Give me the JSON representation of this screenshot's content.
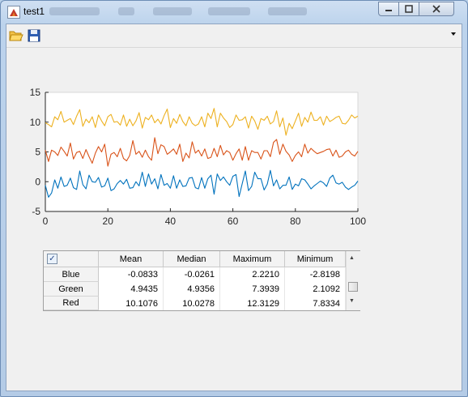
{
  "window": {
    "title": "test1"
  },
  "toolbar": {
    "open_icon": "folder-open-icon",
    "save_icon": "floppy-save-icon",
    "overflow_icon": "chevron-down-icon"
  },
  "chart_data": {
    "type": "line",
    "xlim": [
      0,
      100
    ],
    "ylim": [
      -5,
      15
    ],
    "x_ticks": [
      "0",
      "20",
      "40",
      "60",
      "80",
      "100"
    ],
    "y_ticks": [
      "15",
      "10",
      "5",
      "0",
      "-5"
    ],
    "grid": false,
    "legend": "none",
    "series": [
      {
        "color": "#edb120",
        "values": [
          9.9,
          9.6,
          9.2,
          10.9,
          10.4,
          11.8,
          10.0,
          10.3,
          10.6,
          9.6,
          11.0,
          12.1,
          9.3,
          10.5,
          9.9,
          10.9,
          9.1,
          11.2,
          10.2,
          9.4,
          10.9,
          11.3,
          10.0,
          10.1,
          9.5,
          11.2,
          9.3,
          10.5,
          9.4,
          10.2,
          11.6,
          9.0,
          10.8,
          10.4,
          11.2,
          9.9,
          10.5,
          9.7,
          11.1,
          12.2,
          9.1,
          10.6,
          9.8,
          11.3,
          10.1,
          9.4,
          10.9,
          9.8,
          9.4,
          9.7,
          10.9,
          9.2,
          11.5,
          10.6,
          12.3,
          9.2,
          11.5,
          10.7,
          10.1,
          9.1,
          9.6,
          11.2,
          10.3,
          10.4,
          10.9,
          9.0,
          11.0,
          10.2,
          8.8,
          10.6,
          10.3,
          11.0,
          9.7,
          10.1,
          11.9,
          9.2,
          10.7,
          7.8,
          9.8,
          8.9,
          10.2,
          11.5,
          9.3,
          10.8,
          10.0,
          11.7,
          10.3,
          10.3,
          10.9,
          9.5,
          11.0,
          10.1,
          10.4,
          10.8,
          11.0,
          9.8,
          9.7,
          10.3,
          11.2,
          10.7,
          11.0
        ]
      },
      {
        "color": "#d95319",
        "values": [
          5.3,
          3.4,
          5.3,
          5.0,
          4.4,
          5.8,
          5.1,
          4.3,
          6.5,
          3.8,
          4.9,
          5.1,
          3.9,
          5.4,
          4.2,
          3.1,
          4.8,
          5.9,
          5.0,
          6.3,
          2.6,
          4.6,
          4.9,
          4.2,
          5.6,
          3.9,
          3.5,
          4.4,
          6.9,
          4.6,
          5.1,
          4.1,
          5.3,
          4.2,
          3.6,
          7.4,
          4.7,
          6.2,
          5.9,
          4.6,
          5.0,
          5.5,
          4.6,
          6.3,
          3.4,
          4.8,
          4.0,
          6.7,
          4.8,
          5.3,
          4.3,
          5.5,
          3.9,
          4.1,
          5.6,
          4.2,
          6.1,
          4.5,
          5.2,
          4.9,
          3.6,
          4.7,
          5.5,
          3.6,
          5.9,
          3.6,
          5.2,
          4.9,
          4.9,
          3.8,
          5.2,
          5.2,
          4.2,
          6.6,
          7.1,
          4.6,
          6.3,
          5.1,
          4.5,
          3.4,
          4.4,
          5.0,
          4.2,
          6.3,
          4.8,
          5.6,
          5.1,
          4.7,
          4.9,
          5.1,
          5.4,
          5.5,
          4.3,
          5.3,
          4.1,
          4.3,
          5.0,
          5.3,
          4.6,
          4.3,
          5.1
        ]
      },
      {
        "color": "#0072bd",
        "values": [
          -0.6,
          -2.6,
          -1.9,
          0.3,
          -1.1,
          0.8,
          -0.8,
          -0.6,
          0.6,
          -1.0,
          -1.3,
          1.8,
          -0.5,
          -1.2,
          1.1,
          0.0,
          -0.1,
          0.7,
          -0.9,
          -0.7,
          0.6,
          -1.5,
          -1.2,
          -0.3,
          0.2,
          -0.4,
          0.4,
          -1.1,
          -1.0,
          0.0,
          -0.7,
          1.6,
          -0.8,
          1.3,
          -0.4,
          0.5,
          -1.2,
          1.2,
          -0.6,
          -0.3,
          -1.1,
          1.0,
          -1.1,
          0.3,
          -0.8,
          -0.7,
          0.6,
          0.7,
          -1.0,
          -1.2,
          0.7,
          -1.1,
          0.5,
          1.1,
          -2.1,
          1.3,
          0.2,
          0.8,
          0.0,
          -0.6,
          0.9,
          1.2,
          -2.5,
          -0.3,
          1.8,
          -1.5,
          -0.8,
          1.6,
          0.5,
          0.5,
          -1.4,
          -0.4,
          1.9,
          -0.7,
          0.3,
          -1.2,
          -0.6,
          -0.6,
          0.8,
          -1.3,
          -0.4,
          -0.7,
          0.5,
          0.3,
          -0.4,
          -1.2,
          -0.7,
          -0.3,
          0.1,
          -0.2,
          -0.8,
          0.6,
          1.1,
          -0.2,
          -0.4,
          -0.1,
          -0.9,
          -1.3,
          -0.9,
          -0.6,
          0.1
        ]
      }
    ]
  },
  "table": {
    "checked": true,
    "columns": [
      "Mean",
      "Median",
      "Maximum",
      "Minimum"
    ],
    "rows": [
      {
        "name": "Blue",
        "values": [
          "-0.0833",
          "-0.0261",
          "2.2210",
          "-2.8198"
        ]
      },
      {
        "name": "Green",
        "values": [
          "4.9435",
          "4.9356",
          "7.3939",
          "2.1092"
        ]
      },
      {
        "name": "Red",
        "values": [
          "10.1076",
          "10.0278",
          "12.3129",
          "7.8334"
        ]
      }
    ]
  }
}
